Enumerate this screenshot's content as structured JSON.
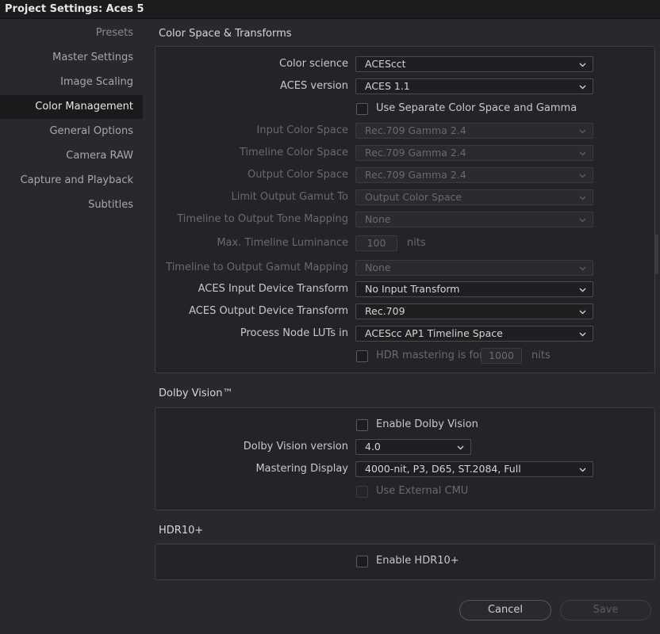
{
  "window": {
    "title": "Project Settings:  Aces 5"
  },
  "sidebar": {
    "items": [
      {
        "label": "Presets"
      },
      {
        "label": "Master Settings"
      },
      {
        "label": "Image Scaling"
      },
      {
        "label": "Color Management"
      },
      {
        "label": "General Options"
      },
      {
        "label": "Camera RAW"
      },
      {
        "label": "Capture and Playback"
      },
      {
        "label": "Subtitles"
      }
    ],
    "active": "Color Management"
  },
  "color_space": {
    "title": "Color Space & Transforms",
    "color_science": {
      "label": "Color science",
      "value": "ACEScct"
    },
    "aces_version": {
      "label": "ACES version",
      "value": "ACES 1.1"
    },
    "separate_cs_gamma": {
      "label": "Use Separate Color Space and Gamma",
      "checked": false
    },
    "input_color_space": {
      "label": "Input Color Space",
      "value": "Rec.709 Gamma 2.4"
    },
    "timeline_color_space": {
      "label": "Timeline Color Space",
      "value": "Rec.709 Gamma 2.4"
    },
    "output_color_space": {
      "label": "Output Color Space",
      "value": "Rec.709 Gamma 2.4"
    },
    "limit_output_gamut": {
      "label": "Limit Output Gamut To",
      "value": "Output Color Space"
    },
    "tone_mapping": {
      "label": "Timeline to Output Tone Mapping",
      "value": "None"
    },
    "max_luminance": {
      "label": "Max. Timeline Luminance",
      "value": "100",
      "unit": "nits"
    },
    "gamut_mapping": {
      "label": "Timeline to Output Gamut Mapping",
      "value": "None"
    },
    "aces_idt": {
      "label": "ACES Input Device Transform",
      "value": "No Input Transform"
    },
    "aces_odt": {
      "label": "ACES Output Device Transform",
      "value": "Rec.709"
    },
    "process_node_luts": {
      "label": "Process Node LUTs in",
      "value": "ACEScc AP1 Timeline Space"
    },
    "hdr_mastering": {
      "label": "HDR mastering is for",
      "value": "1000",
      "unit": "nits",
      "checked": false
    }
  },
  "dolby_vision": {
    "title": "Dolby Vision™",
    "enable": {
      "label": "Enable Dolby Vision",
      "checked": false
    },
    "version": {
      "label": "Dolby Vision version",
      "value": "4.0"
    },
    "mastering_display": {
      "label": "Mastering Display",
      "value": "4000-nit, P3, D65, ST.2084, Full"
    },
    "external_cmu": {
      "label": "Use External CMU",
      "checked": false
    }
  },
  "hdr10plus": {
    "title": "HDR10+",
    "enable": {
      "label": "Enable HDR10+",
      "checked": false
    }
  },
  "footer": {
    "cancel_label": "Cancel",
    "save_label": "Save"
  },
  "colors": {
    "background": "#28282e",
    "panel": "#242428",
    "active_item": "#1a1a1d",
    "disabled_text": "#6a6a6e"
  }
}
